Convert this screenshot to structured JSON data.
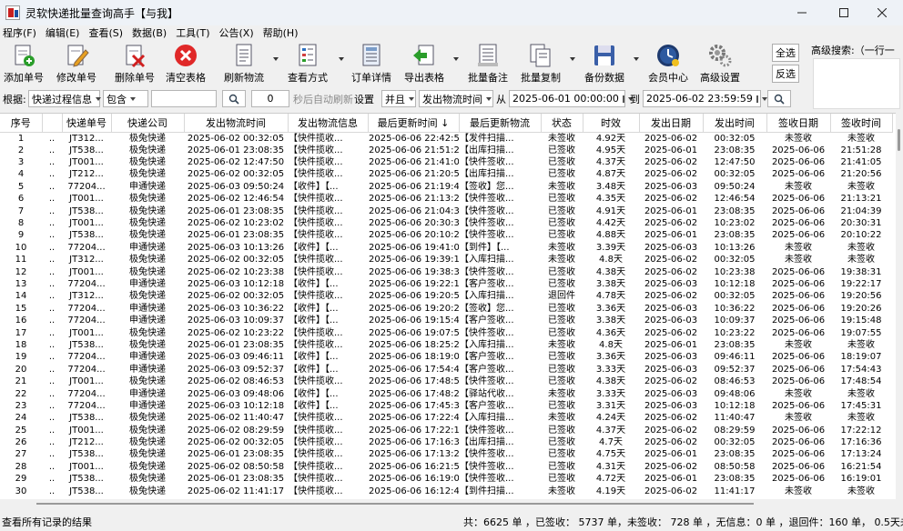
{
  "window": {
    "title": "灵软快递批量查询高手【与我】",
    "min_icon": "minimize-icon",
    "max_icon": "maximize-icon",
    "close_icon": "close-icon"
  },
  "menu": [
    "程序(F)",
    "编辑(E)",
    "查看(S)",
    "数据(B)",
    "工具(T)",
    "公告(X)",
    "帮助(H)"
  ],
  "toolbar": {
    "add": "添加单号",
    "edit": "修改单号",
    "delete": "删除单号",
    "clear": "清空表格",
    "refresh": "刷新物流",
    "view": "查看方式",
    "detail": "订单详情",
    "export": "导出表格",
    "note": "批量备注",
    "copy": "批量复制",
    "backup": "备份数据",
    "member": "会员中心",
    "settings": "高级设置",
    "select_all": "全选",
    "invert": "反选"
  },
  "advanced_search": {
    "label": "高级搜索:（一行一"
  },
  "filter": {
    "by_label": "根据:",
    "field": "快递过程信息",
    "op": "包含",
    "keyword": "",
    "seconds": "0",
    "auto_refresh": "秒后自动刷新",
    "set": "设置",
    "and": "并且",
    "date_field": "发出物流时间",
    "from": "从",
    "start": "2025-06-01 00:00:00",
    "to": "到",
    "end": "2025-06-02 23:59:59"
  },
  "columns": [
    "序号",
    "",
    "快递单号",
    "快递公司",
    "发出物流时间",
    "发出物流信息",
    "最后更新时间 ↓",
    "最后更新物流",
    "状态",
    "时效",
    "发出日期",
    "发出时间",
    "签收日期",
    "签收时间"
  ],
  "rows": [
    [
      "1",
      "..",
      "JT312...",
      "极兔快递",
      "2025-06-02 00:32:05",
      "【快件揽收...",
      "2025-06-06 22:42:51",
      "【发件扫描...",
      "未签收",
      "4.92天",
      "2025-06-02",
      "00:32:05",
      "未签收",
      "未签收"
    ],
    [
      "2",
      "..",
      "JT538...",
      "极兔快递",
      "2025-06-01 23:08:35",
      "【快件揽收...",
      "2025-06-06 21:51:28",
      "【出库扫描...",
      "已签收",
      "4.95天",
      "2025-06-01",
      "23:08:35",
      "2025-06-06",
      "21:51:28"
    ],
    [
      "3",
      "..",
      "JT001...",
      "极兔快递",
      "2025-06-02 12:47:50",
      "【快件揽收...",
      "2025-06-06 21:41:05",
      "【快件签收...",
      "已签收",
      "4.37天",
      "2025-06-02",
      "12:47:50",
      "2025-06-06",
      "21:41:05"
    ],
    [
      "4",
      "..",
      "JT212...",
      "极兔快递",
      "2025-06-02 00:32:05",
      "【快件揽收...",
      "2025-06-06 21:20:56",
      "【出库扫描...",
      "已签收",
      "4.87天",
      "2025-06-02",
      "00:32:05",
      "2025-06-06",
      "21:20:56"
    ],
    [
      "5",
      "..",
      "77204...",
      "申通快递",
      "2025-06-03 09:50:24",
      "【收件】【...",
      "2025-06-06 21:19:49",
      "【签收】您...",
      "未签收",
      "3.48天",
      "2025-06-03",
      "09:50:24",
      "未签收",
      "未签收"
    ],
    [
      "6",
      "..",
      "JT001...",
      "极兔快递",
      "2025-06-02 12:46:54",
      "【快件揽收...",
      "2025-06-06 21:13:21",
      "【快件签收...",
      "已签收",
      "4.35天",
      "2025-06-02",
      "12:46:54",
      "2025-06-06",
      "21:13:21"
    ],
    [
      "7",
      "..",
      "JT538...",
      "极兔快递",
      "2025-06-01 23:08:35",
      "【快件揽收...",
      "2025-06-06 21:04:39",
      "【快件签收...",
      "已签收",
      "4.91天",
      "2025-06-01",
      "23:08:35",
      "2025-06-06",
      "21:04:39"
    ],
    [
      "8",
      "..",
      "JT001...",
      "极兔快递",
      "2025-06-02 10:23:02",
      "【快件揽收...",
      "2025-06-06 20:30:31",
      "【快件签收...",
      "已签收",
      "4.42天",
      "2025-06-02",
      "10:23:02",
      "2025-06-06",
      "20:30:31"
    ],
    [
      "9",
      "..",
      "JT538...",
      "极兔快递",
      "2025-06-01 23:08:35",
      "【快件揽收...",
      "2025-06-06 20:10:22",
      "【快件签收...",
      "已签收",
      "4.88天",
      "2025-06-01",
      "23:08:35",
      "2025-06-06",
      "20:10:22"
    ],
    [
      "10",
      "..",
      "77204...",
      "申通快递",
      "2025-06-03 10:13:26",
      "【收件】【...",
      "2025-06-06 19:41:07",
      "【到件】【...",
      "未签收",
      "3.39天",
      "2025-06-03",
      "10:13:26",
      "未签收",
      "未签收"
    ],
    [
      "11",
      "..",
      "JT312...",
      "极兔快递",
      "2025-06-02 00:32:05",
      "【快件揽收...",
      "2025-06-06 19:39:11",
      "【入库扫描...",
      "未签收",
      "4.8天",
      "2025-06-02",
      "00:32:05",
      "未签收",
      "未签收"
    ],
    [
      "12",
      "..",
      "JT001...",
      "极兔快递",
      "2025-06-02 10:23:38",
      "【快件揽收...",
      "2025-06-06 19:38:31",
      "【快件签收...",
      "已签收",
      "4.38天",
      "2025-06-02",
      "10:23:38",
      "2025-06-06",
      "19:38:31"
    ],
    [
      "13",
      "..",
      "77204...",
      "申通快递",
      "2025-06-03 10:12:18",
      "【收件】【...",
      "2025-06-06 19:22:17",
      "【客户签收...",
      "已签收",
      "3.38天",
      "2025-06-03",
      "10:12:18",
      "2025-06-06",
      "19:22:17"
    ],
    [
      "14",
      "..",
      "JT312...",
      "极兔快递",
      "2025-06-02 00:32:05",
      "【快件揽收...",
      "2025-06-06 19:20:56",
      "【入库扫描...",
      "退回件",
      "4.78天",
      "2025-06-02",
      "00:32:05",
      "2025-06-06",
      "19:20:56"
    ],
    [
      "15",
      "..",
      "77204...",
      "申通快递",
      "2025-06-03 10:36:22",
      "【收件】【...",
      "2025-06-06 19:20:26",
      "【签收】您...",
      "已签收",
      "3.36天",
      "2025-06-03",
      "10:36:22",
      "2025-06-06",
      "19:20:26"
    ],
    [
      "16",
      "..",
      "77204...",
      "申通快递",
      "2025-06-03 10:09:37",
      "【收件】【...",
      "2025-06-06 19:15:48",
      "【客户签收...",
      "已签收",
      "3.38天",
      "2025-06-03",
      "10:09:37",
      "2025-06-06",
      "19:15:48"
    ],
    [
      "17",
      "..",
      "JT001...",
      "极兔快递",
      "2025-06-02 10:23:22",
      "【快件揽收...",
      "2025-06-06 19:07:55",
      "【快件签收...",
      "已签收",
      "4.36天",
      "2025-06-02",
      "10:23:22",
      "2025-06-06",
      "19:07:55"
    ],
    [
      "18",
      "..",
      "JT538...",
      "极兔快递",
      "2025-06-01 23:08:35",
      "【快件揽收...",
      "2025-06-06 18:25:23",
      "【入库扫描...",
      "未签收",
      "4.8天",
      "2025-06-01",
      "23:08:35",
      "未签收",
      "未签收"
    ],
    [
      "19",
      "..",
      "77204...",
      "申通快递",
      "2025-06-03 09:46:11",
      "【收件】【...",
      "2025-06-06 18:19:07",
      "【客户签收...",
      "已签收",
      "3.36天",
      "2025-06-03",
      "09:46:11",
      "2025-06-06",
      "18:19:07"
    ],
    [
      "20",
      "..",
      "77204...",
      "申通快递",
      "2025-06-03 09:52:37",
      "【收件】【...",
      "2025-06-06 17:54:43",
      "【客户签收...",
      "已签收",
      "3.33天",
      "2025-06-03",
      "09:52:37",
      "2025-06-06",
      "17:54:43"
    ],
    [
      "21",
      "..",
      "JT001...",
      "极兔快递",
      "2025-06-02 08:46:53",
      "【快件揽收...",
      "2025-06-06 17:48:54",
      "【快件签收...",
      "已签收",
      "4.38天",
      "2025-06-02",
      "08:46:53",
      "2025-06-06",
      "17:48:54"
    ],
    [
      "22",
      "..",
      "77204...",
      "申通快递",
      "2025-06-03 09:48:06",
      "【收件】【...",
      "2025-06-06 17:48:27",
      "【驿站代收...",
      "未签收",
      "3.33天",
      "2025-06-03",
      "09:48:06",
      "未签收",
      "未签收"
    ],
    [
      "23",
      "..",
      "77204...",
      "申通快递",
      "2025-06-03 10:12:18",
      "【收件】【...",
      "2025-06-06 17:45:31",
      "【客户签收...",
      "已签收",
      "3.31天",
      "2025-06-03",
      "10:12:18",
      "2025-06-06",
      "17:45:31"
    ],
    [
      "24",
      "..",
      "JT538...",
      "极兔快递",
      "2025-06-02 11:40:47",
      "【快件揽收...",
      "2025-06-06 17:22:40",
      "【入库扫描...",
      "未签收",
      "4.24天",
      "2025-06-02",
      "11:40:47",
      "未签收",
      "未签收"
    ],
    [
      "25",
      "..",
      "JT001...",
      "极兔快递",
      "2025-06-02 08:29:59",
      "【快件揽收...",
      "2025-06-06 17:22:12",
      "【快件签收...",
      "已签收",
      "4.37天",
      "2025-06-02",
      "08:29:59",
      "2025-06-06",
      "17:22:12"
    ],
    [
      "26",
      "..",
      "JT212...",
      "极兔快递",
      "2025-06-02 00:32:05",
      "【快件揽收...",
      "2025-06-06 17:16:36",
      "【出库扫描...",
      "已签收",
      "4.7天",
      "2025-06-02",
      "00:32:05",
      "2025-06-06",
      "17:16:36"
    ],
    [
      "27",
      "..",
      "JT538...",
      "极兔快递",
      "2025-06-01 23:08:35",
      "【快件揽收...",
      "2025-06-06 17:13:24",
      "【快件签收...",
      "已签收",
      "4.75天",
      "2025-06-01",
      "23:08:35",
      "2025-06-06",
      "17:13:24"
    ],
    [
      "28",
      "..",
      "JT001...",
      "极兔快递",
      "2025-06-02 08:50:58",
      "【快件揽收...",
      "2025-06-06 16:21:54",
      "【快件签收...",
      "已签收",
      "4.31天",
      "2025-06-02",
      "08:50:58",
      "2025-06-06",
      "16:21:54"
    ],
    [
      "29",
      "..",
      "JT538...",
      "极兔快递",
      "2025-06-01 23:08:35",
      "【快件揽收...",
      "2025-06-06 16:19:01",
      "【快件签收...",
      "已签收",
      "4.72天",
      "2025-06-01",
      "23:08:35",
      "2025-06-06",
      "16:19:01"
    ],
    [
      "30",
      "..",
      "JT538...",
      "极兔快递",
      "2025-06-02 11:41:17",
      "【快件揽收...",
      "2025-06-06 16:12:40",
      "【到件扫描...",
      "未签收",
      "4.19天",
      "2025-06-02",
      "11:41:17",
      "未签收",
      "未签收"
    ]
  ],
  "status": {
    "left": "查看所有记录的结果",
    "right": "共：6625 单 ，已签收： 5737 单，未签收： 728 单 ，无信息：0 单 ，退回件：160 单， 0.5天未更新："
  }
}
